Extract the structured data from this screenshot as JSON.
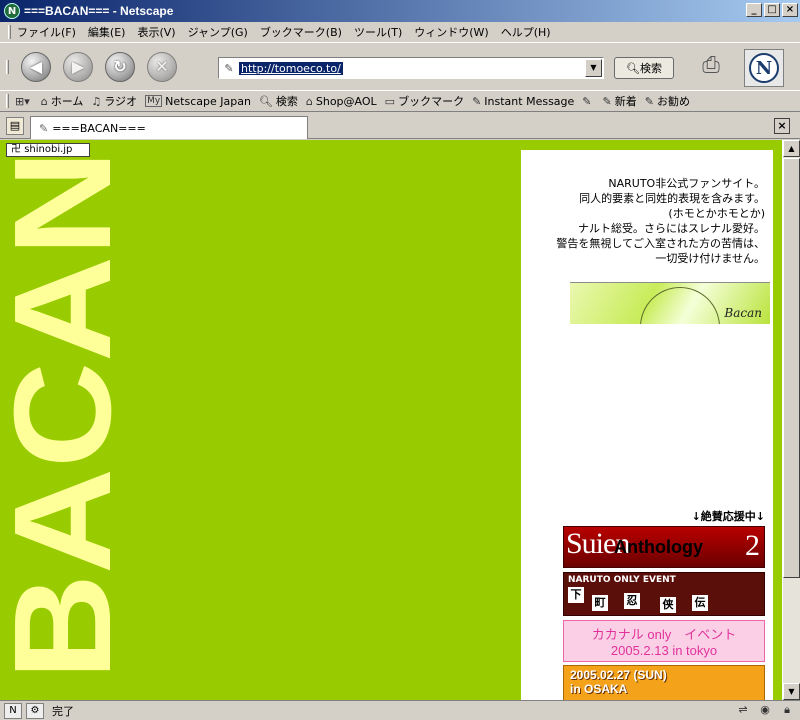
{
  "window": {
    "title": "===BACAN=== - Netscape",
    "controls": [
      "_",
      "□",
      "×"
    ]
  },
  "menu": [
    {
      "label": "ファイル(F)"
    },
    {
      "label": "編集(E)"
    },
    {
      "label": "表示(V)"
    },
    {
      "label": "ジャンプ(G)"
    },
    {
      "label": "ブックマーク(B)"
    },
    {
      "label": "ツール(T)"
    },
    {
      "label": "ウィンドウ(W)"
    },
    {
      "label": "ヘルプ(H)"
    }
  ],
  "navbar": {
    "url": "http://tomoeco.to/",
    "search_label": "検索"
  },
  "personal_toolbar": [
    {
      "label": "ホーム",
      "icon": "home-icon"
    },
    {
      "label": "ラジオ",
      "icon": "radio-icon"
    },
    {
      "label": "Netscape Japan",
      "icon": "my-icon",
      "icon_text": "My"
    },
    {
      "label": "検索",
      "icon": "search-icon"
    },
    {
      "label": "Shop@AOL",
      "icon": "shop-icon"
    },
    {
      "label": "ブックマーク",
      "icon": "folder-icon"
    },
    {
      "label": "Instant Message",
      "icon": "bookmark-icon"
    },
    {
      "label": "",
      "icon": "bookmark-icon"
    },
    {
      "label": "新着",
      "icon": "bookmark-icon"
    },
    {
      "label": "お勧め",
      "icon": "bookmark-icon"
    }
  ],
  "tab": {
    "label": "===BACAN==="
  },
  "page": {
    "shinobi_label": "shinobi.jp",
    "logo_text": "BACAN",
    "notice_lines": [
      "NARUTO非公式ファンサイト。",
      "同人的要素と同姓的表現を含みます。",
      "(ホモとかホモとか)",
      "ナルト総受。さらにはスレナル愛好。",
      "警告を無視してご入室された方の苦情は、",
      "一切受け付けません。"
    ],
    "header_banner_signature": "Bacan",
    "support_heading": "↓絶賛応援中↓",
    "banners": {
      "b1": {
        "big": "Suien",
        "overlay": "Anthology",
        "number": "2"
      },
      "b2": {
        "title": "NARUTO ONLY EVENT",
        "kanji": [
          "下",
          "町",
          "忍",
          "侠",
          "伝"
        ]
      },
      "b3": {
        "line1": "カカナル only　イベント",
        "line2": "2005.2.13 in tokyo"
      },
      "b4": {
        "line1": "2005.02.27 (SUN)",
        "line2": "in OSAKA"
      }
    }
  },
  "status": {
    "text": "完了"
  },
  "colors": {
    "page_bg": "#99cc00",
    "logo": "#ffff99"
  }
}
